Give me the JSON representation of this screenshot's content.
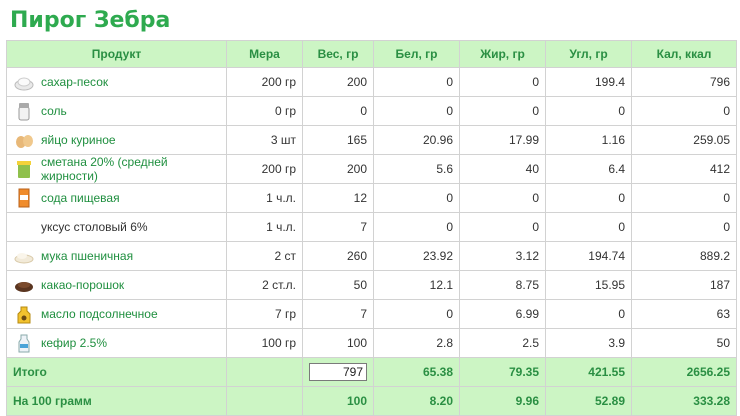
{
  "page": {
    "title": "Пирог Зебра"
  },
  "table": {
    "headers": {
      "product": "Продукт",
      "measure": "Мера",
      "weight": "Вес, гр",
      "protein": "Бел, гр",
      "fat": "Жир, гр",
      "carb": "Угл, гр",
      "kcal": "Кал, ккал"
    },
    "rows": [
      {
        "name": "сахар-песок",
        "icon": "sugar-icon",
        "measure": "200 гр",
        "weight": "200",
        "protein": "0",
        "fat": "0",
        "carb": "199.4",
        "kcal": "796"
      },
      {
        "name": "соль",
        "icon": "salt-icon",
        "measure": "0 гр",
        "weight": "0",
        "protein": "0",
        "fat": "0",
        "carb": "0",
        "kcal": "0"
      },
      {
        "name": "яйцо куриное",
        "icon": "egg-icon",
        "measure": "3 шт",
        "weight": "165",
        "protein": "20.96",
        "fat": "17.99",
        "carb": "1.16",
        "kcal": "259.05"
      },
      {
        "name": "сметана 20% (средней жирности)",
        "icon": "sour-cream-icon",
        "measure": "200 гр",
        "weight": "200",
        "protein": "5.6",
        "fat": "40",
        "carb": "6.4",
        "kcal": "412"
      },
      {
        "name": "сода пищевая",
        "icon": "baking-soda-icon",
        "measure": "1 ч.л.",
        "weight": "12",
        "protein": "0",
        "fat": "0",
        "carb": "0",
        "kcal": "0"
      },
      {
        "name": "уксус столовый 6%",
        "icon": "",
        "measure": "1 ч.л.",
        "weight": "7",
        "protein": "0",
        "fat": "0",
        "carb": "0",
        "kcal": "0"
      },
      {
        "name": "мука пшеничная",
        "icon": "flour-icon",
        "measure": "2 ст",
        "weight": "260",
        "protein": "23.92",
        "fat": "3.12",
        "carb": "194.74",
        "kcal": "889.2"
      },
      {
        "name": "какао-порошок",
        "icon": "cocoa-icon",
        "measure": "2 ст.л.",
        "weight": "50",
        "protein": "12.1",
        "fat": "8.75",
        "carb": "15.95",
        "kcal": "187"
      },
      {
        "name": "масло подсолнечное",
        "icon": "sunflower-oil-icon",
        "measure": "7 гр",
        "weight": "7",
        "protein": "0",
        "fat": "6.99",
        "carb": "0",
        "kcal": "63"
      },
      {
        "name": "кефир 2.5%",
        "icon": "kefir-icon",
        "measure": "100 гр",
        "weight": "100",
        "protein": "2.8",
        "fat": "2.5",
        "carb": "3.9",
        "kcal": "50"
      }
    ],
    "total": {
      "label": "Итого",
      "weight": "797",
      "protein": "65.38",
      "fat": "79.35",
      "carb": "421.55",
      "kcal": "2656.25"
    },
    "per100": {
      "label": "На 100 грамм",
      "weight": "100",
      "protein": "8.20",
      "fat": "9.96",
      "carb": "52.89",
      "kcal": "333.28"
    }
  },
  "colors": {
    "accent": "#2eaa4f",
    "header_bg": "#ccf5c4",
    "link": "#1f8f3f"
  }
}
